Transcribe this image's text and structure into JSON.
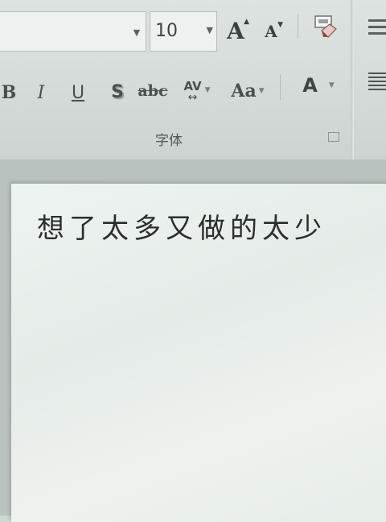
{
  "ribbon": {
    "font_size": {
      "value": "10"
    },
    "buttons": {
      "grow_font": "A",
      "shrink_font": "A",
      "bold": "B",
      "italic": "I",
      "underline": "U",
      "shadow": "S",
      "strikethrough": "abc",
      "char_spacing": "AV",
      "change_case": "Aa",
      "font_color": "A"
    },
    "group_label": "字体"
  },
  "document": {
    "text": "想了太多又做的太少"
  }
}
